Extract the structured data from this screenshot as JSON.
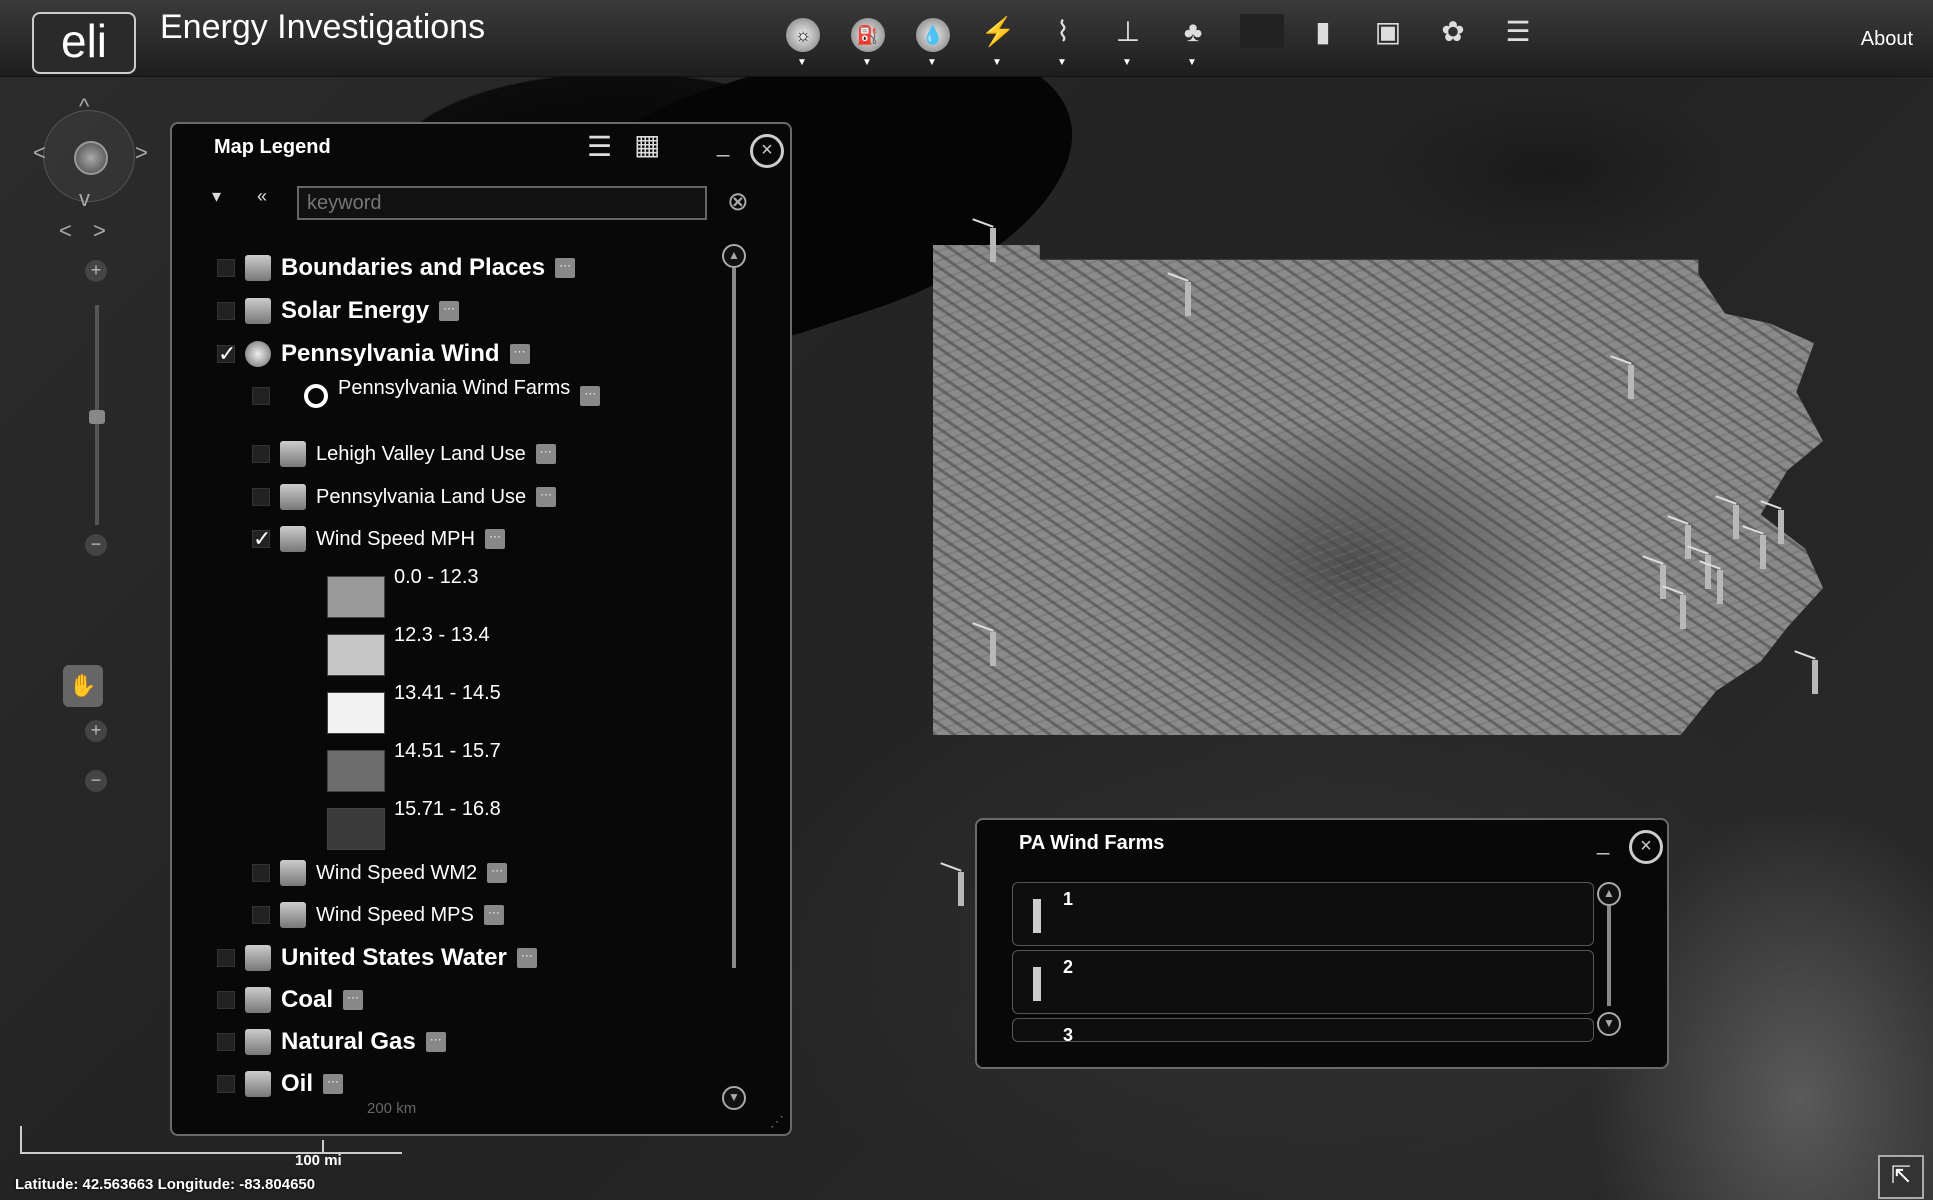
{
  "app": {
    "logo": "eli",
    "title": "Energy Investigations",
    "about": "About"
  },
  "toolbar": {
    "icons": [
      "sun-icon",
      "oil-derrick-icon",
      "water-drop-icon",
      "wind-turbine-icon",
      "power-line-icon",
      "pipeline-icon",
      "plant-icon",
      "blank-tool",
      "book-icon",
      "image-icon",
      "palette-icon",
      "list-icon"
    ]
  },
  "legend": {
    "title": "Map Legend",
    "search_placeholder": "keyword",
    "items": [
      {
        "label": "Boundaries and Places",
        "checked": false
      },
      {
        "label": "Solar Energy",
        "checked": false
      },
      {
        "label": "Pennsylvania Wind",
        "checked": true
      },
      {
        "label": "Pennsylvania Wind Farms",
        "checked": false
      },
      {
        "label": "Lehigh Valley Land Use",
        "checked": false
      },
      {
        "label": "Pennsylvania Land Use",
        "checked": false
      },
      {
        "label": "Wind Speed MPH",
        "checked": true
      },
      {
        "label": "Wind Speed WM2",
        "checked": false
      },
      {
        "label": "Wind Speed MPS",
        "checked": false
      },
      {
        "label": "United States Water",
        "checked": false
      },
      {
        "label": "Coal",
        "checked": false
      },
      {
        "label": "Natural Gas",
        "checked": false
      },
      {
        "label": "Oil",
        "checked": false
      }
    ],
    "wind_speed_classes": [
      {
        "label": "0.0 - 12.3",
        "color": "#9a9a9a"
      },
      {
        "label": "12.3 - 13.4",
        "color": "#c6c6c6"
      },
      {
        "label": "13.41 - 14.5",
        "color": "#f2f2f2"
      },
      {
        "label": "14.51 - 15.7",
        "color": "#6c6c6c"
      },
      {
        "label": "15.71 - 16.8",
        "color": "#3a3a3a"
      }
    ],
    "scale_text": "200 km"
  },
  "wind_farms_panel": {
    "title": "PA Wind Farms",
    "items": [
      "1",
      "2",
      "3"
    ]
  },
  "map": {
    "scale_label": "100 mi",
    "status": "Latitude: 42.563663   Longitude: -83.804650"
  }
}
